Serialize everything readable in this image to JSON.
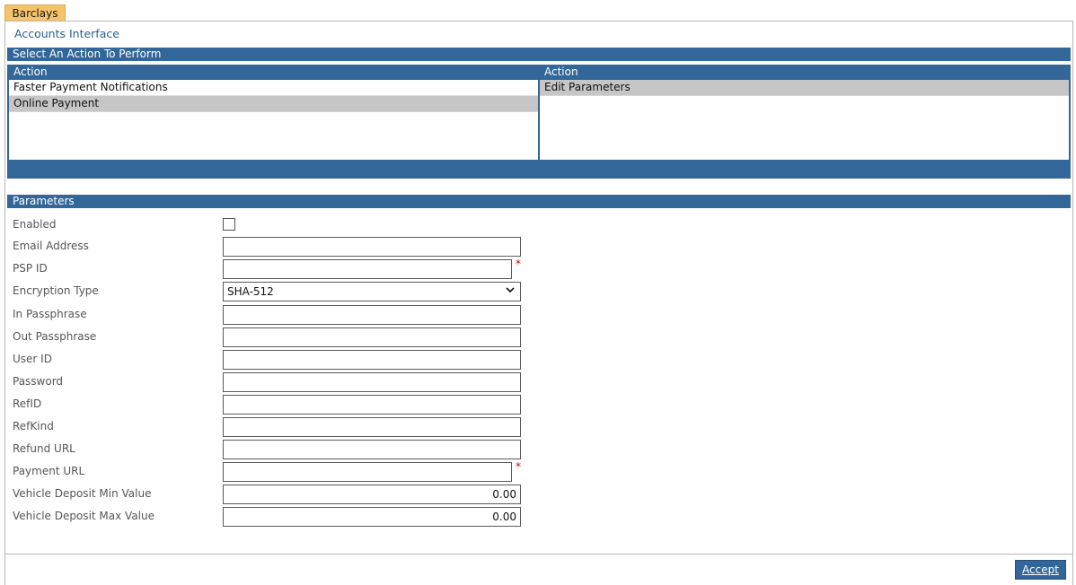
{
  "tab": {
    "label": "Barclays"
  },
  "page": {
    "title": "Accounts Interface"
  },
  "select_section": {
    "title": "Select An Action To Perform"
  },
  "left_list": {
    "header": "Action",
    "items": [
      {
        "label": "Faster Payment Notifications",
        "selected": false
      },
      {
        "label": "Online Payment",
        "selected": true
      }
    ]
  },
  "right_list": {
    "header": "Action",
    "items": [
      {
        "label": "Edit Parameters",
        "selected": true
      }
    ]
  },
  "params_section": {
    "title": "Parameters"
  },
  "params": {
    "enabled": {
      "label": "Enabled",
      "checked": false
    },
    "email": {
      "label": "Email Address",
      "value": ""
    },
    "psp_id": {
      "label": "PSP ID",
      "value": "",
      "required_mark": "*"
    },
    "encryption": {
      "label": "Encryption Type",
      "value": "SHA-512"
    },
    "in_pass": {
      "label": "In Passphrase",
      "value": ""
    },
    "out_pass": {
      "label": "Out Passphrase",
      "value": ""
    },
    "user_id": {
      "label": "User ID",
      "value": ""
    },
    "password": {
      "label": "Password",
      "value": ""
    },
    "ref_id": {
      "label": "RefID",
      "value": ""
    },
    "ref_kind": {
      "label": "RefKind",
      "value": ""
    },
    "refund_url": {
      "label": "Refund URL",
      "value": ""
    },
    "payment_url": {
      "label": "Payment URL",
      "value": "",
      "required_mark": "*"
    },
    "dep_min": {
      "label": "Vehicle Deposit Min Value",
      "value": "0.00"
    },
    "dep_max": {
      "label": "Vehicle Deposit Max Value",
      "value": "0.00"
    }
  },
  "actions": {
    "accept_label": "Accept"
  },
  "colors": {
    "header_blue": "#336699",
    "tab_orange": "#f4c36a",
    "title_blue": "#2a5f93",
    "required_red": "#cc0000",
    "selected_gray": "#c6c6c6"
  }
}
